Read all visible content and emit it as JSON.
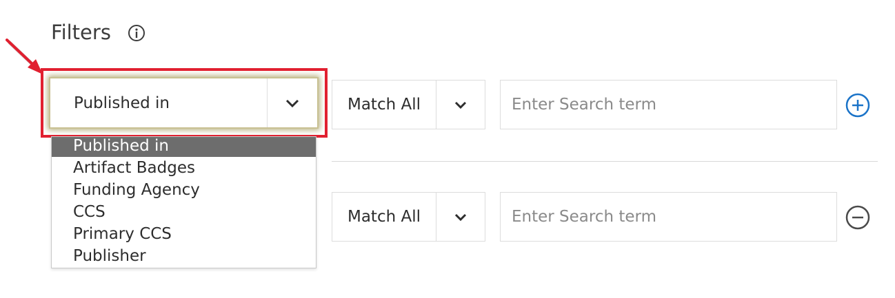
{
  "title": "Filters",
  "rows": [
    {
      "field": "Published in",
      "match": "Match All",
      "search_placeholder": "Enter Search term",
      "search_value": "",
      "action": "add"
    },
    {
      "field": "",
      "match": "Match All",
      "search_placeholder": "Enter Search term",
      "search_value": "",
      "action": "remove"
    }
  ],
  "dropdown": {
    "open": true,
    "selected": "Published in",
    "options": [
      "Published in",
      "Artifact Badges",
      "Funding Agency",
      "CCS",
      "Primary CCS",
      "Publisher"
    ]
  },
  "icons": {
    "info": "info-circle-icon",
    "chevron": "chevron-down-icon",
    "add": "plus-circle-icon",
    "remove": "minus-circle-icon",
    "callout": "red-arrow-icon"
  },
  "colors": {
    "highlight": "#e12030",
    "accent_blue": "#1a73c8",
    "selected_option_bg": "#6d6d6d",
    "remove_icon": "#4a4a4a"
  }
}
